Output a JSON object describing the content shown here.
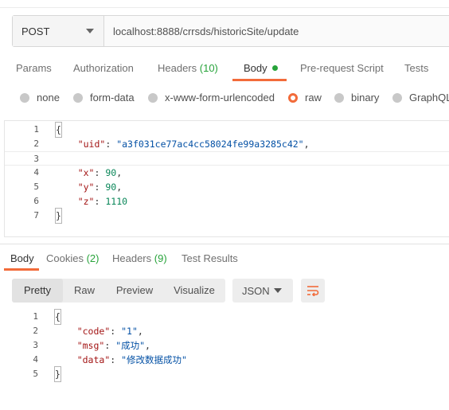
{
  "request": {
    "method": "POST",
    "url": "localhost:8888/crrsds/historicSite/update"
  },
  "request_tabs": {
    "params": "Params",
    "authorization": "Authorization",
    "headers_label": "Headers",
    "headers_count": "(10)",
    "body": "Body",
    "prerequest": "Pre-request Script",
    "tests": "Tests"
  },
  "body_types": {
    "none": "none",
    "form_data": "form-data",
    "urlencoded": "x-www-form-urlencoded",
    "raw": "raw",
    "binary": "binary",
    "graphql": "GraphQL"
  },
  "request_body": {
    "line_numbers": [
      "1",
      "2",
      "3",
      "4",
      "5",
      "6",
      "7"
    ],
    "open": "{",
    "close": "}",
    "uid_key": "\"uid\"",
    "uid_value": "\"a3f031ce77ac4cc58024fe99a3285c42\"",
    "x_key": "\"x\"",
    "x_value": "90",
    "y_key": "\"y\"",
    "y_value": "90",
    "z_key": "\"z\"",
    "z_value": "1110"
  },
  "response_tabs": {
    "body": "Body",
    "cookies_label": "Cookies",
    "cookies_count": "(2)",
    "headers_label": "Headers",
    "headers_count": "(9)",
    "test_results": "Test Results"
  },
  "response_toolbar": {
    "pretty": "Pretty",
    "raw": "Raw",
    "preview": "Preview",
    "visualize": "Visualize",
    "format": "JSON"
  },
  "response_body": {
    "line_numbers": [
      "1",
      "2",
      "3",
      "4",
      "5"
    ],
    "open": "{",
    "close": "}",
    "code_key": "\"code\"",
    "code_value": "\"1\"",
    "msg_key": "\"msg\"",
    "msg_value": "\"成功\"",
    "data_key": "\"data\"",
    "data_value": "\"修改数据成功\""
  },
  "colors": {
    "accent": "#f26b3a",
    "count_green": "#27a33a"
  }
}
